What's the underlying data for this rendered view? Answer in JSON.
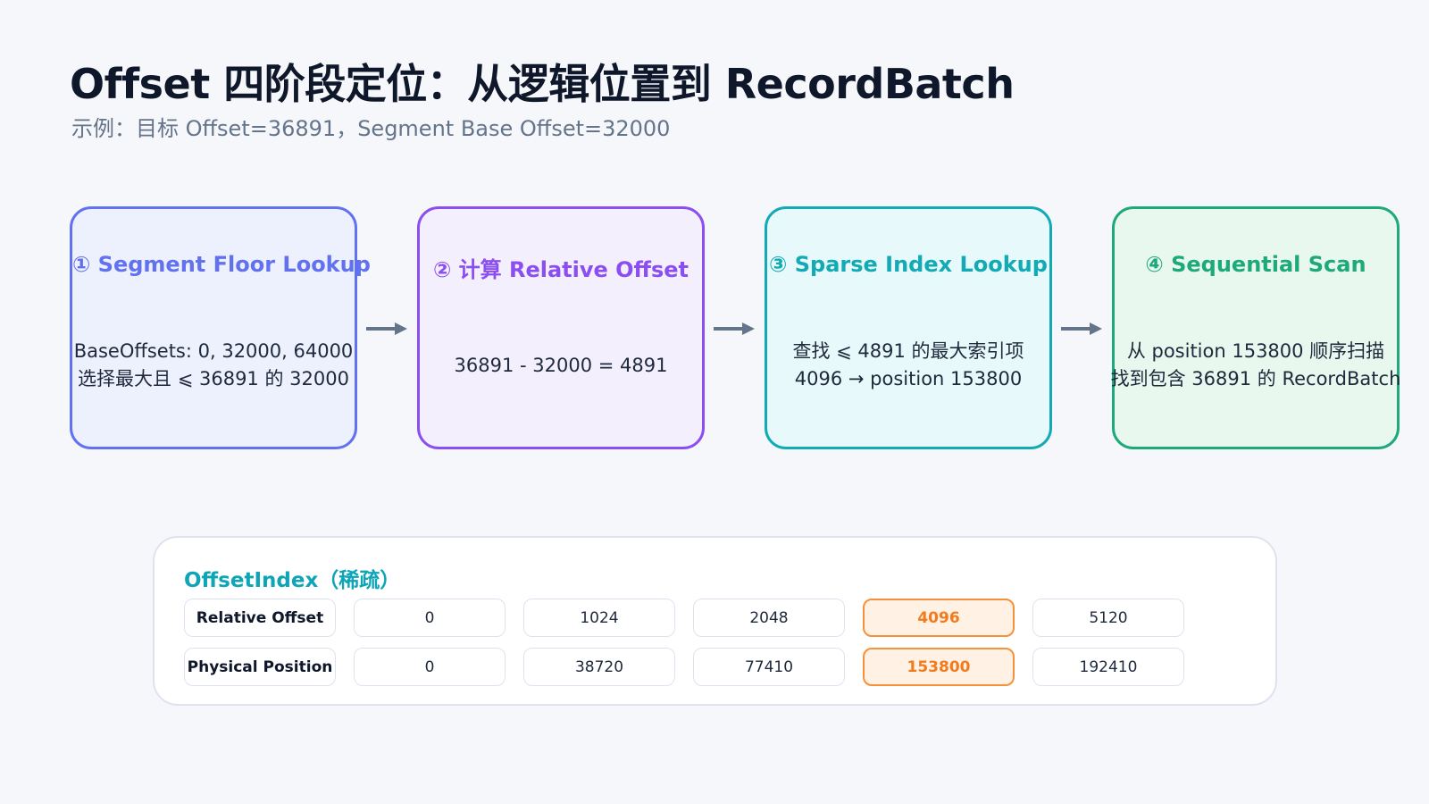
{
  "title": "Offset 四阶段定位：从逻辑位置到 RecordBatch",
  "subtitle": "示例：目标 Offset=36891，Segment Base Offset=32000",
  "stages": [
    {
      "title": "① Segment Floor Lookup",
      "lines": [
        "BaseOffsets: 0, 32000, 64000",
        "选择最大且 ⩽ 36891 的 32000"
      ],
      "color": "#6271f0",
      "bg": "#edf0fd"
    },
    {
      "title": "② 计算 Relative Offset",
      "lines": [
        "36891 - 32000 = 4891"
      ],
      "color": "#8b4ef0",
      "bg": "#f3effd"
    },
    {
      "title": "③ Sparse Index Lookup",
      "lines": [
        "查找 ⩽ 4891 的最大索引项",
        "4096 → position 153800"
      ],
      "color": "#12aab5",
      "bg": "#e7f9fa"
    },
    {
      "title": "④ Sequential Scan",
      "lines": [
        "从 position 153800 顺序扫描",
        "找到包含 36891 的 RecordBatch"
      ],
      "color": "#1ea97a",
      "bg": "#e8f8ef"
    }
  ],
  "arrow_color": "#64748b",
  "offset_index": {
    "title": "OffsetIndex（稀疏）",
    "rows": [
      {
        "header": "Relative Offset",
        "values": [
          "0",
          "1024",
          "2048",
          "4096",
          "5120"
        ]
      },
      {
        "header": "Physical Position",
        "values": [
          "0",
          "38720",
          "77410",
          "153800",
          "192410"
        ]
      }
    ],
    "highlight_column": 3,
    "highlight_color": "#f5913a"
  }
}
